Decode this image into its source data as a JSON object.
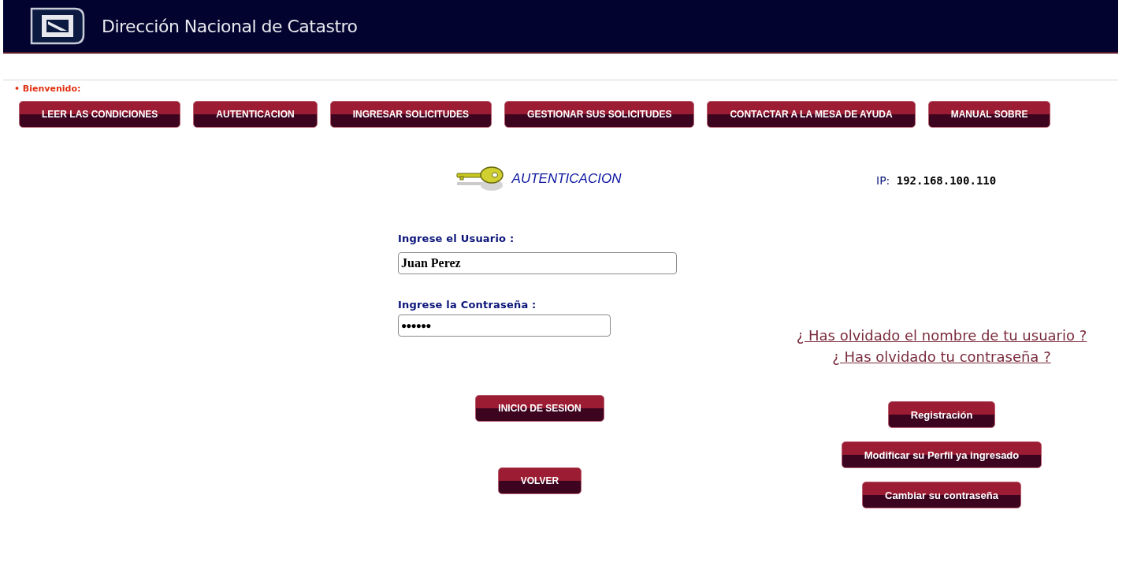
{
  "header": {
    "title": "Dirección Nacional de Catastro"
  },
  "welcome": "• Bienvenido:",
  "nav": [
    {
      "label": "LEER LAS CONDICIONES"
    },
    {
      "label": "AUTENTICACION"
    },
    {
      "label": "INGRESAR SOLICITUDES"
    },
    {
      "label": "GESTIONAR SUS SOLICITUDES"
    },
    {
      "label": "CONTACTAR A LA MESA DE AYUDA"
    },
    {
      "label": "MANUAL SOBRE"
    }
  ],
  "login": {
    "title": "AUTENTICACION",
    "ip_label": "IP:",
    "ip": "192.168.100.110",
    "user_label": "Ingrese el Usuario :",
    "user_value": "Juan Perez",
    "password_label": "Ingrese la Contraseña :",
    "password_value": "●●●●●●",
    "buttons": [
      "INICIO DE SESION",
      "VOLVER"
    ]
  },
  "help_links": [
    "¿ Has olvidado el nombre de tu usuario ?",
    "¿ Has olvidado tu contraseña ?"
  ],
  "account_buttons": [
    "Registración",
    "Modificar su Perfil ya ingresado",
    "Cambiar su contraseña"
  ]
}
